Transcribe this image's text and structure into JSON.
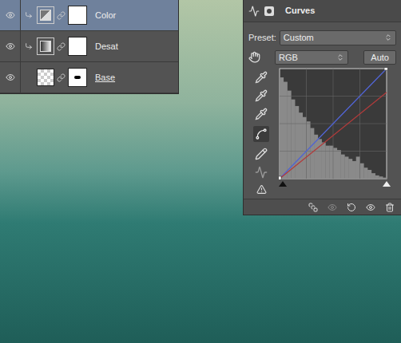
{
  "layers": [
    {
      "name": "Color",
      "selected": true,
      "kind": "curves",
      "clipped": true,
      "underlined": false,
      "visible": true
    },
    {
      "name": "Desat",
      "selected": false,
      "kind": "black-white",
      "clipped": true,
      "underlined": false,
      "visible": true
    },
    {
      "name": "Base",
      "selected": false,
      "kind": "smart-object",
      "clipped": false,
      "underlined": true,
      "visible": true
    }
  ],
  "properties": {
    "title": "Curves",
    "preset_label": "Preset:",
    "preset": "Custom",
    "channel": "RGB",
    "auto_button": "Auto",
    "histogram": [
      0.92,
      0.88,
      0.8,
      0.72,
      0.66,
      0.6,
      0.56,
      0.52,
      0.46,
      0.4,
      0.36,
      0.33,
      0.3,
      0.3,
      0.28,
      0.26,
      0.22,
      0.2,
      0.18,
      0.16,
      0.2,
      0.14,
      0.1,
      0.08,
      0.05,
      0.03,
      0.02,
      0.01
    ],
    "curves": [
      {
        "channel": "Blue",
        "color": "#4f63d6",
        "points": [
          [
            0,
            0
          ],
          [
            255,
            255
          ]
        ]
      },
      {
        "channel": "Red",
        "color": "#b23a3a",
        "points": [
          [
            0,
            0
          ],
          [
            255,
            200
          ]
        ]
      }
    ]
  }
}
